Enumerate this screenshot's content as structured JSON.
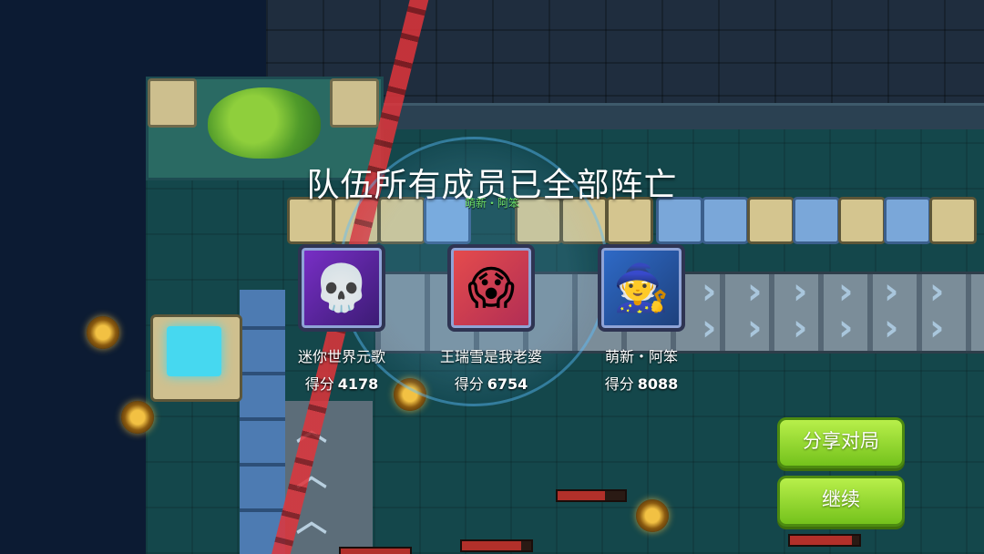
{
  "banner": {
    "title": "队伍所有成员已全部阵亡"
  },
  "overhead_tag": "萌新・阿笨",
  "players": [
    {
      "name": "迷你世界元歌",
      "score_label": "得分",
      "score": "4178",
      "avatar": "skull-icon"
    },
    {
      "name": "王瑞雪是我老婆",
      "score_label": "得分",
      "score": "6754",
      "avatar": "blonde-hero-icon"
    },
    {
      "name": "萌新・阿笨",
      "score_label": "得分",
      "score": "8088",
      "avatar": "wizard-girl-icon"
    }
  ],
  "buttons": {
    "share": "分享对局",
    "continue": "继续"
  },
  "colors": {
    "button_green": "#8fd62c",
    "laser_red": "#e0343a",
    "floor_teal": "#14474b"
  }
}
